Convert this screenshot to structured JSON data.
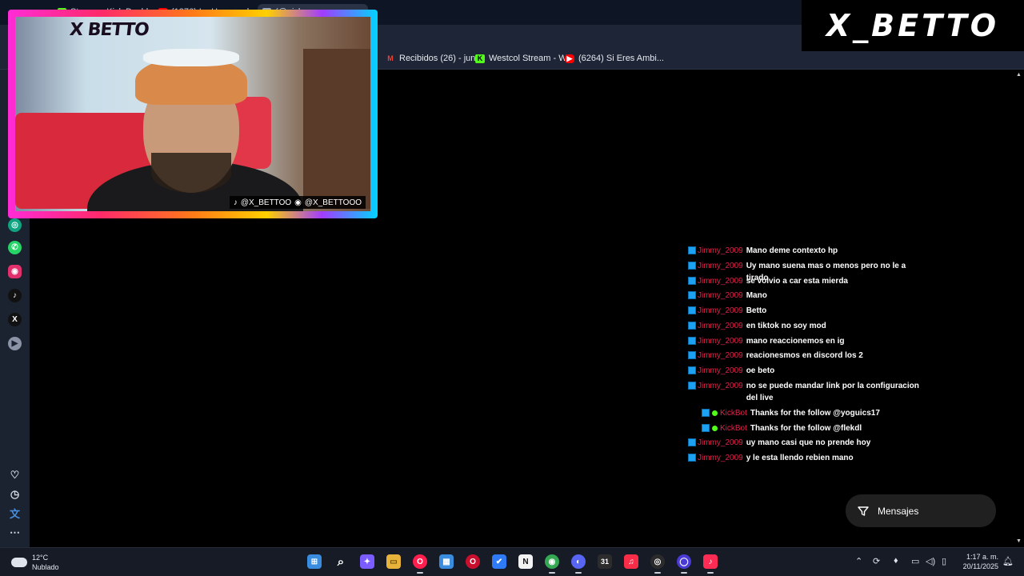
{
  "browser": {
    "tabs": [
      {
        "label": "Stream - Kick Dashboard",
        "color": "#53fc18"
      },
      {
        "label": "(1376) Lo H se mude",
        "color": "#ff0000"
      },
      {
        "label": "(@nicksonnew",
        "color": "#9aa6b8"
      }
    ],
    "bookmarks": [
      {
        "label": "Recibidos (26) - juni...",
        "icon": "gmail-icon",
        "glyph": "M",
        "color": "#ea4335"
      },
      {
        "label": "Westcol Stream - W...",
        "icon": "kick-icon",
        "glyph": "K",
        "color": "#53fc18"
      },
      {
        "label": "(6264) Si Eres Ambi...",
        "icon": "youtube-icon",
        "glyph": "▶",
        "color": "#ff0000"
      }
    ]
  },
  "sidebar": {
    "items": [
      {
        "name": "chatgpt-icon",
        "glyph": "◎",
        "color": "#10a37f"
      },
      {
        "name": "whatsapp-icon",
        "glyph": "✆",
        "color": "#25d366"
      },
      {
        "name": "instagram-icon",
        "glyph": "◉",
        "color": "#e1306c"
      },
      {
        "name": "tiktok-icon",
        "glyph": "♪",
        "color": "#111111"
      },
      {
        "name": "x-icon",
        "glyph": "𝕏",
        "color": "#111111"
      },
      {
        "name": "player-icon",
        "glyph": "▶",
        "color": "#8a94a6"
      }
    ],
    "bottom": [
      {
        "name": "heart-icon",
        "glyph": "♡"
      },
      {
        "name": "history-icon",
        "glyph": "◷"
      },
      {
        "name": "translate-icon",
        "glyph": "文"
      },
      {
        "name": "more-icon",
        "glyph": "⋯"
      }
    ]
  },
  "webcam": {
    "logo": "X BETTO",
    "tiktok_handle": "@X_BETTOO",
    "instagram_handle": "@X_BETTOOO"
  },
  "brand": {
    "text": "X_BETTO"
  },
  "chat": {
    "messages": [
      {
        "user": "Jimmy_2009",
        "text": "Mano deme contexto hp",
        "bot": false
      },
      {
        "user": "Jimmy_2009",
        "text": "Uy mano suena mas o menos pero no le a tirado",
        "bot": false
      },
      {
        "user": "Jimmy_2009",
        "text": "se volvio a car esta mierda",
        "bot": false
      },
      {
        "user": "Jimmy_2009",
        "text": "Mano",
        "bot": false
      },
      {
        "user": "Jimmy_2009",
        "text": "Betto",
        "bot": false
      },
      {
        "user": "Jimmy_2009",
        "text": "en tiktok no soy mod",
        "bot": false
      },
      {
        "user": "Jimmy_2009",
        "text": "mano reaccionemos en ig",
        "bot": false
      },
      {
        "user": "Jimmy_2009",
        "text": "reacionesmos en discord los 2",
        "bot": false
      },
      {
        "user": "Jimmy_2009",
        "text": "oe beto",
        "bot": false
      },
      {
        "user": "Jimmy_2009",
        "text": "no se puede mandar link por la configuracion del live",
        "bot": false
      },
      {
        "user": "KickBot",
        "text": "Thanks for the follow @yoguics17",
        "bot": true
      },
      {
        "user": "KickBot",
        "text": "Thanks for the follow @flekdl",
        "bot": true
      },
      {
        "user": "Jimmy_2009",
        "text": "uy mano casi que no prende hoy",
        "bot": false
      },
      {
        "user": "Jimmy_2009",
        "text": "y le esta llendo rebien mano",
        "bot": false
      }
    ],
    "filter_button_label": "Mensajes"
  },
  "taskbar": {
    "weather_temp": "12°C",
    "weather_desc": "Nublado",
    "apps": [
      {
        "name": "start-icon",
        "glyph": "⊞",
        "color": "#3a8dde"
      },
      {
        "name": "search-icon",
        "glyph": "⌕",
        "color": "#161b26"
      },
      {
        "name": "copilot-icon",
        "glyph": "✦",
        "color": "#7b5cff"
      },
      {
        "name": "file-explorer-icon",
        "glyph": "▭",
        "color": "#e8b33a"
      },
      {
        "name": "opera-gx-icon",
        "glyph": "O",
        "color": "#ff1e4d"
      },
      {
        "name": "store-icon",
        "glyph": "▦",
        "color": "#3a8dde"
      },
      {
        "name": "opera-icon",
        "glyph": "O",
        "color": "#c8102e"
      },
      {
        "name": "todo-icon",
        "glyph": "✔",
        "color": "#2f7bf5"
      },
      {
        "name": "notion-icon",
        "glyph": "N",
        "color": "#f2f2f2"
      },
      {
        "name": "chrome-icon",
        "glyph": "◉",
        "color": "#34a853"
      },
      {
        "name": "discord-icon",
        "glyph": "◐",
        "color": "#5865f2"
      },
      {
        "name": "calendar-icon",
        "glyph": "31",
        "color": "#2c2c2c"
      },
      {
        "name": "itunes-icon",
        "glyph": "♫",
        "color": "#fa2d48"
      },
      {
        "name": "obs-icon",
        "glyph": "◎",
        "color": "#2b2b2b"
      },
      {
        "name": "browser-icon",
        "glyph": "◯",
        "color": "#4b3bd6"
      },
      {
        "name": "tiktok-app-icon",
        "glyph": "♪",
        "color": "#fe2c55"
      }
    ],
    "time": "1:17 a. m.",
    "date": "20/11/2025"
  }
}
